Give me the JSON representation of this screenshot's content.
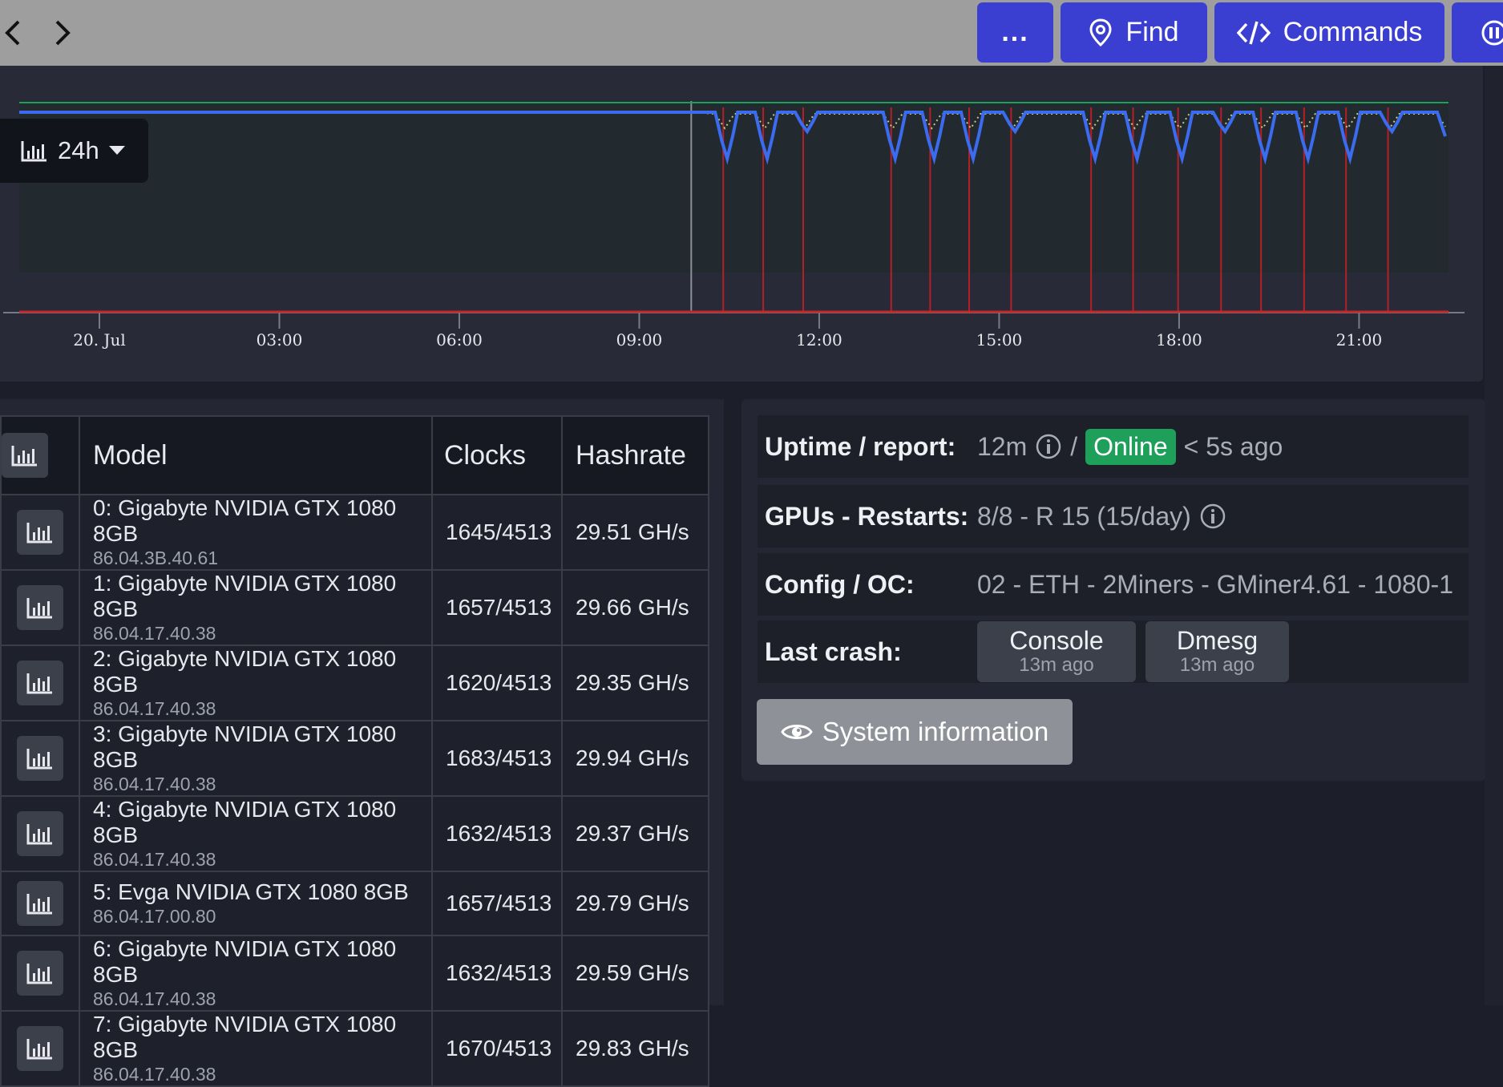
{
  "toolbar": {
    "more_label": "...",
    "find_label": "Find",
    "commands_label": "Commands"
  },
  "chart_data": {
    "type": "line",
    "x_ticks": [
      "20. Jul",
      "03:00",
      "06:00",
      "09:00",
      "12:00",
      "15:00",
      "18:00",
      "21:00"
    ],
    "range_label": "24h",
    "series": [
      {
        "color": "#3b6cf0",
        "style": "solid"
      },
      {
        "color": "#c8c87a",
        "style": "dotted"
      },
      {
        "color": "#1fa05a",
        "style": "solid"
      }
    ],
    "dip_times": [
      "10:32",
      "11:12",
      "11:52",
      "13:20",
      "13:59",
      "14:38",
      "15:20",
      "16:40",
      "17:22",
      "18:07",
      "18:50",
      "19:30",
      "20:13",
      "20:55",
      "21:37"
    ],
    "marker_time": "09:52"
  },
  "gpu_table": {
    "columns": [
      "Model",
      "Clocks",
      "Hashrate"
    ],
    "rows": [
      {
        "model": "0: Gigabyte NVIDIA GTX 1080 8GB",
        "version": "86.04.3B.40.61",
        "clocks": "1645/4513",
        "hashrate": "29.51 GH/s"
      },
      {
        "model": "1: Gigabyte NVIDIA GTX 1080 8GB",
        "version": "86.04.17.40.38",
        "clocks": "1657/4513",
        "hashrate": "29.66 GH/s"
      },
      {
        "model": "2: Gigabyte NVIDIA GTX 1080 8GB",
        "version": "86.04.17.40.38",
        "clocks": "1620/4513",
        "hashrate": "29.35 GH/s"
      },
      {
        "model": "3: Gigabyte NVIDIA GTX 1080 8GB",
        "version": "86.04.17.40.38",
        "clocks": "1683/4513",
        "hashrate": "29.94 GH/s"
      },
      {
        "model": "4: Gigabyte NVIDIA GTX 1080 8GB",
        "version": "86.04.17.40.38",
        "clocks": "1632/4513",
        "hashrate": "29.37 GH/s"
      },
      {
        "model": "5: Evga NVIDIA GTX 1080 8GB",
        "version": "86.04.17.00.80",
        "clocks": "1657/4513",
        "hashrate": "29.79 GH/s"
      },
      {
        "model": "6: Gigabyte NVIDIA GTX 1080 8GB",
        "version": "86.04.17.40.38",
        "clocks": "1632/4513",
        "hashrate": "29.59 GH/s"
      },
      {
        "model": "7: Gigabyte NVIDIA GTX 1080 8GB",
        "version": "86.04.17.40.38",
        "clocks": "1670/4513",
        "hashrate": "29.83 GH/s"
      }
    ]
  },
  "info": {
    "uptime_label": "Uptime / report:",
    "uptime_value": "12m",
    "uptime_sep": "/",
    "status": "Online",
    "report_age": "< 5s ago",
    "gpus_label": "GPUs - Restarts:",
    "gpus_value": "8/8 - R 15 (15/day)",
    "config_label": "Config / OC:",
    "config_value": "02 - ETH - 2Miners - GMiner4.61 - 1080-1",
    "crash_label": "Last crash:",
    "console_label": "Console",
    "console_age": "13m ago",
    "dmesg_label": "Dmesg",
    "dmesg_age": "13m ago",
    "sysinfo_label": "System information"
  },
  "colors": {
    "accent": "#3b3fd1",
    "online": "#1fa05a",
    "hashrate_line": "#3b6cf0",
    "restart_marker": "#b42026"
  }
}
